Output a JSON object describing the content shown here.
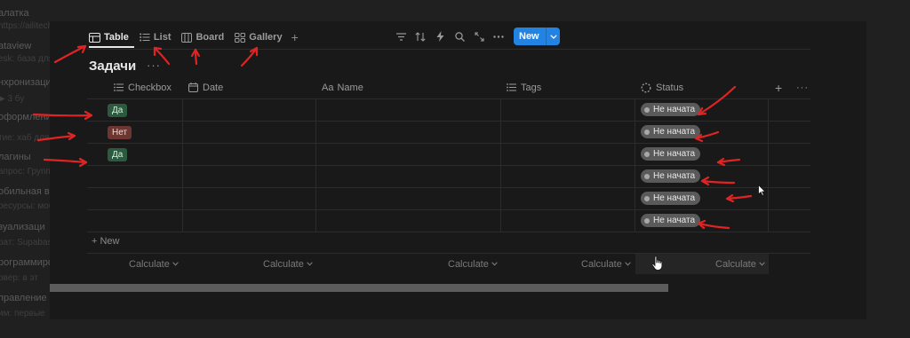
{
  "background_sidebar": [
    {
      "text": "алатка",
      "style": "main"
    },
    {
      "text": "https://ailitech",
      "style": "sub"
    },
    {
      "text": "ataview",
      "style": "main"
    },
    {
      "text": "esk: база для",
      "style": "sub"
    },
    {
      "text": "нхронизаци",
      "style": "main"
    },
    {
      "text": "▶ 3 бу",
      "style": "sub"
    },
    {
      "text": "оформление",
      "style": "main"
    },
    {
      "text": "тие: хаб для",
      "style": "sub"
    },
    {
      "text": "лагины",
      "style": "main"
    },
    {
      "text": "апрос: Группы",
      "style": "sub"
    },
    {
      "text": "обильная в",
      "style": "main"
    },
    {
      "text": "ресурсы: мобил",
      "style": "sub"
    },
    {
      "text": "зуализаци",
      "style": "main"
    },
    {
      "text": "рат: Supabase",
      "style": "sub"
    },
    {
      "text": "рограммиро",
      "style": "main"
    },
    {
      "text": "рвер: в эт",
      "style": "sub"
    },
    {
      "text": "правление",
      "style": "main"
    },
    {
      "text": "им: первые",
      "style": "sub"
    }
  ],
  "view_tabs": [
    {
      "label": "Table",
      "icon": "table-icon",
      "active": true
    },
    {
      "label": "List",
      "icon": "list-icon",
      "active": false
    },
    {
      "label": "Board",
      "icon": "board-icon",
      "active": false
    },
    {
      "label": "Gallery",
      "icon": "gallery-icon",
      "active": false
    }
  ],
  "add_view_symbol": "+",
  "toolbar": {
    "icons": [
      "filter-icon",
      "sort-icon",
      "automation-icon",
      "search-icon",
      "expand-icon",
      "more-icon"
    ],
    "new_label": "New"
  },
  "database": {
    "title": "Задачи",
    "more_symbol": "···"
  },
  "columns": [
    {
      "label": "Checkbox",
      "icon": "list-icon"
    },
    {
      "label": "Date",
      "icon": "calendar-icon"
    },
    {
      "label": "Name",
      "icon": "text-icon",
      "prefix": "Aa"
    },
    {
      "label": "Tags",
      "icon": "list-icon"
    },
    {
      "label": "Status",
      "icon": "status-icon"
    }
  ],
  "header_add_symbol": "+",
  "header_more_symbol": "···",
  "rows": [
    {
      "checkbox": "Да",
      "checkbox_kind": "yes",
      "status": "Не начата"
    },
    {
      "checkbox": "Нет",
      "checkbox_kind": "no",
      "status": "Не начата"
    },
    {
      "checkbox": "Да",
      "checkbox_kind": "yes",
      "status": "Не начата"
    },
    {
      "checkbox": "",
      "checkbox_kind": "",
      "status": "Не начата"
    },
    {
      "checkbox": "",
      "checkbox_kind": "",
      "status": "Не начата"
    },
    {
      "checkbox": "",
      "checkbox_kind": "",
      "status": "Не начата"
    }
  ],
  "new_row_label": "+ New",
  "calculate": [
    "Calculate",
    "Calculate",
    "Calculate",
    "Calculate",
    "Calculate"
  ],
  "colors": {
    "accent": "#2383e2",
    "yes_badge": "#2b5a3e",
    "no_badge": "#6e3630",
    "status_badge": "#5a5a5a",
    "annotation_arrow": "#e02424"
  }
}
